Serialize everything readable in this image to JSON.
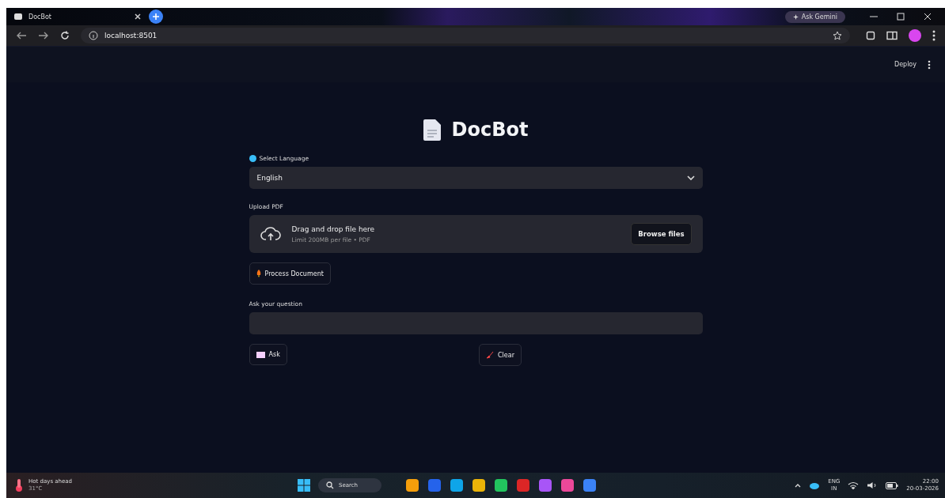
{
  "browser": {
    "tab_title": "DocBot",
    "address": "localhost:8501",
    "ask_gemini": "Ask Gemini"
  },
  "app_header": {
    "deploy": "Deploy"
  },
  "main": {
    "title": "DocBot",
    "language": {
      "label": "Select Language",
      "value": "English"
    },
    "upload": {
      "label": "Upload PDF",
      "drop_text": "Drag and drop file here",
      "limit": "Limit 200MB per file • PDF",
      "browse": "Browse files"
    },
    "process_button": "Process Document",
    "question": {
      "label": "Ask your question"
    },
    "ask_button": "Ask",
    "clear_button": "Clear"
  },
  "taskbar": {
    "weather_title": "Hot days ahead",
    "weather_temp": "31°C",
    "search_placeholder": "Search",
    "lang_top": "ENG",
    "lang_bottom": "IN",
    "time": "22:00",
    "date": "20-03-2026"
  }
}
